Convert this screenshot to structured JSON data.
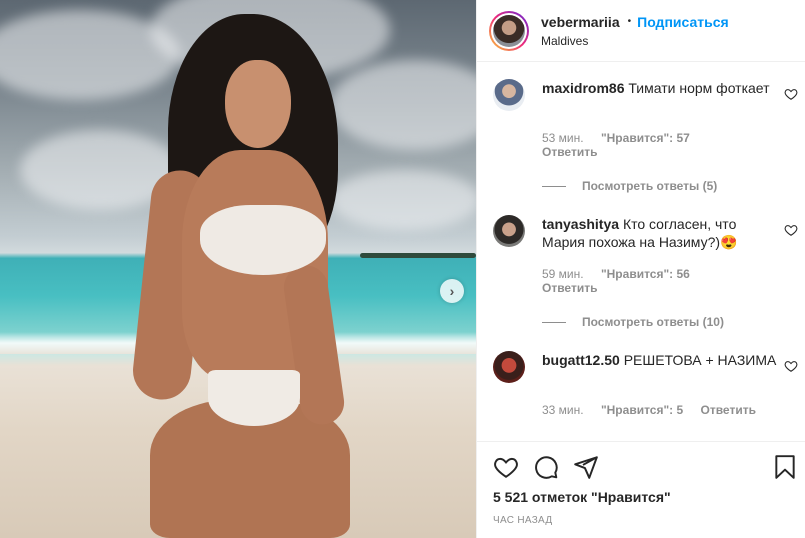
{
  "post": {
    "photo_icon": "beach-photo",
    "next_icon": "chevron-right-icon"
  },
  "header": {
    "username": "vebermariia",
    "separator": "•",
    "follow_label": "Подписаться",
    "location": "Maldives"
  },
  "comments": [
    {
      "username": "maxidrom86",
      "text": "Тимати норм фоткает",
      "time": "53 мин.",
      "likes": "\"Нравится\": 57",
      "reply_label": "Ответить",
      "view_replies": "Посмотреть ответы (5)"
    },
    {
      "username": "tanyashitya",
      "text": "Кто согласен, что Мария похожа на Назиму?)😍",
      "time": "59 мин.",
      "likes": "\"Нравится\": 56",
      "reply_label": "Ответить",
      "view_replies": "Посмотреть ответы (10)"
    },
    {
      "username": "bugatt12.50",
      "text": "РЕШЕТОВА + НАЗИМА",
      "time": "33 мин.",
      "likes": "\"Нравится\": 5",
      "reply_label": "Ответить"
    }
  ],
  "footer": {
    "likes": "5 521 отметок \"Нравится\"",
    "time": "ЧАС НАЗАД"
  },
  "colors": {
    "accent": "#0095f6",
    "text": "#262626",
    "muted": "#8e8e8e",
    "border": "#efefef"
  }
}
